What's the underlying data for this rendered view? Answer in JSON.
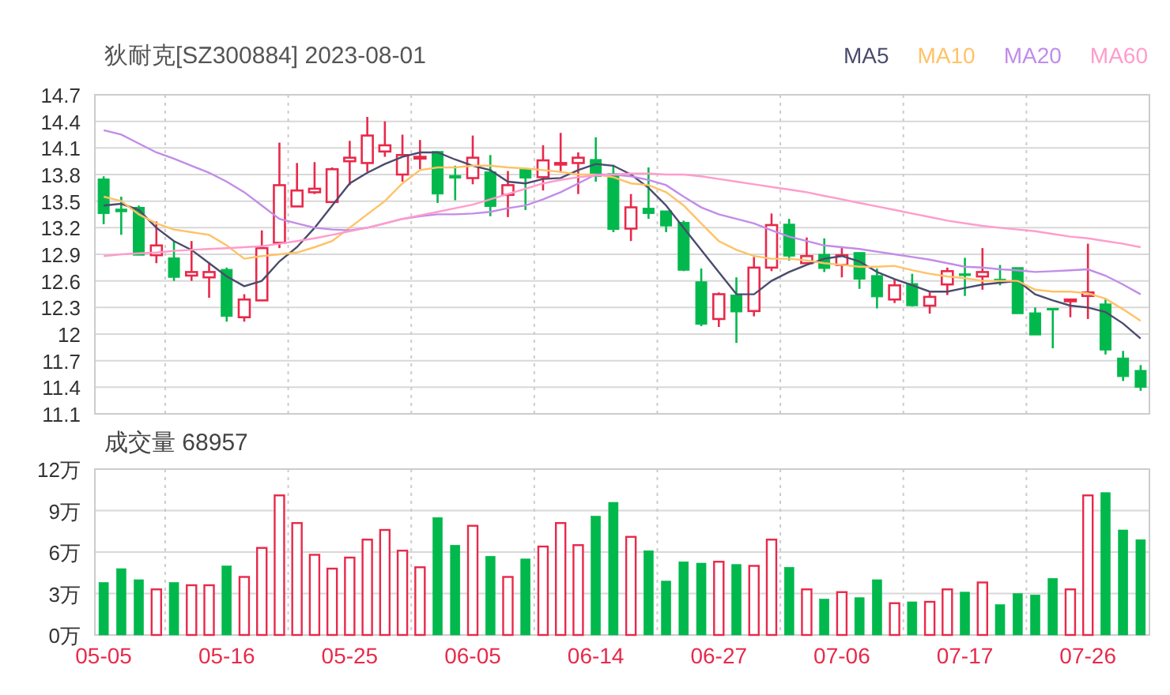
{
  "price_chart": {
    "chart_data": {
      "type": "line",
      "title": "狄耐克[SZ300884] 2023-08-01",
      "ylim": [
        11.1,
        14.7
      ],
      "categories": [
        null,
        null,
        null,
        null,
        null,
        null,
        null,
        null,
        null,
        null,
        null,
        null,
        null,
        null,
        null,
        null,
        null,
        null,
        null,
        null,
        null,
        null,
        null,
        null,
        null,
        null,
        null,
        null,
        null,
        null,
        null,
        null,
        null,
        null,
        null,
        null,
        null,
        null,
        null,
        null,
        null,
        null,
        null,
        null,
        null,
        null,
        null,
        null,
        null,
        null,
        null,
        null,
        null,
        null,
        null,
        null,
        null,
        null,
        null,
        null
      ],
      "series": [
        {
          "name": "MA5",
          "color": "#4b4b6e",
          "values": [
            13.45,
            13.47,
            13.4,
            13.2,
            13.05,
            12.95,
            12.8,
            12.65,
            12.54,
            12.6,
            12.82,
            12.98,
            13.2,
            13.45,
            13.7,
            13.82,
            13.92,
            14.0,
            14.05,
            14.05,
            13.97,
            13.9,
            13.85,
            13.72,
            13.7,
            13.75,
            13.76,
            13.85,
            13.92,
            13.9,
            13.8,
            13.65,
            13.45,
            13.2,
            12.95,
            12.7,
            12.45,
            12.45,
            12.6,
            12.7,
            12.78,
            12.85,
            12.88,
            12.82,
            12.7,
            12.62,
            12.55,
            12.48,
            12.48,
            12.52,
            12.56,
            12.58,
            12.6,
            12.45,
            12.38,
            12.32,
            12.3,
            12.25,
            12.12,
            11.95
          ]
        },
        {
          "name": "MA10",
          "color": "#ffc266",
          "values": [
            13.55,
            13.5,
            13.35,
            13.25,
            13.18,
            13.15,
            13.12,
            13.0,
            12.85,
            12.88,
            12.9,
            12.92,
            12.98,
            13.05,
            13.2,
            13.35,
            13.5,
            13.7,
            13.85,
            13.88,
            13.88,
            13.9,
            13.9,
            13.88,
            13.87,
            13.85,
            13.83,
            13.8,
            13.8,
            13.77,
            13.7,
            13.68,
            13.6,
            13.45,
            13.25,
            13.05,
            12.95,
            12.88,
            12.85,
            12.85,
            12.83,
            12.8,
            12.78,
            12.76,
            12.76,
            12.77,
            12.72,
            12.68,
            12.65,
            12.63,
            12.6,
            12.6,
            12.6,
            12.5,
            12.48,
            12.48,
            12.46,
            12.4,
            12.28,
            12.15
          ]
        },
        {
          "name": "MA20",
          "color": "#c28ce8",
          "values": [
            14.3,
            14.25,
            14.15,
            14.05,
            13.98,
            13.9,
            13.82,
            13.72,
            13.6,
            13.45,
            13.3,
            13.25,
            13.2,
            13.18,
            13.17,
            13.2,
            13.25,
            13.3,
            13.33,
            13.35,
            13.35,
            13.36,
            13.38,
            13.42,
            13.45,
            13.52,
            13.6,
            13.7,
            13.8,
            13.8,
            13.78,
            13.74,
            13.68,
            13.55,
            13.43,
            13.35,
            13.3,
            13.25,
            13.17,
            13.1,
            13.05,
            13.0,
            12.98,
            12.96,
            12.93,
            12.9,
            12.87,
            12.84,
            12.8,
            12.76,
            12.75,
            12.73,
            12.72,
            12.7,
            12.71,
            12.72,
            12.73,
            12.66,
            12.56,
            12.45
          ]
        },
        {
          "name": "MA60",
          "color": "#ff9ccc",
          "values": [
            12.88,
            12.9,
            12.91,
            12.92,
            12.94,
            12.95,
            12.96,
            12.97,
            12.98,
            12.99,
            13.02,
            13.05,
            13.08,
            13.12,
            13.16,
            13.2,
            13.25,
            13.3,
            13.34,
            13.38,
            13.42,
            13.46,
            13.52,
            13.58,
            13.64,
            13.7,
            13.74,
            13.77,
            13.79,
            13.8,
            13.81,
            13.81,
            13.8,
            13.8,
            13.78,
            13.75,
            13.72,
            13.69,
            13.66,
            13.63,
            13.6,
            13.56,
            13.52,
            13.48,
            13.44,
            13.4,
            13.36,
            13.32,
            13.28,
            13.25,
            13.22,
            13.2,
            13.18,
            13.16,
            13.13,
            13.1,
            13.08,
            13.05,
            13.02,
            12.98
          ]
        }
      ]
    }
  },
  "candles": {
    "chart_data": {
      "type": "candlestick",
      "ylim": [
        11.1,
        14.7
      ],
      "grid": true,
      "yticks": [
        {
          "value": 14.7,
          "label": "14.7"
        },
        {
          "value": 14.4,
          "label": "14.4"
        },
        {
          "value": 14.1,
          "label": "14.1"
        },
        {
          "value": 13.8,
          "label": "13.8"
        },
        {
          "value": 13.5,
          "label": "13.5"
        },
        {
          "value": 13.2,
          "label": "13.2"
        },
        {
          "value": 12.9,
          "label": "12.9"
        },
        {
          "value": 12.6,
          "label": "12.6"
        },
        {
          "value": 12.3,
          "label": "12.3"
        },
        {
          "value": 12,
          "label": "12"
        },
        {
          "value": 11.7,
          "label": "11.7"
        },
        {
          "value": 11.4,
          "label": "11.4"
        },
        {
          "value": 11.1,
          "label": "11.1"
        }
      ],
      "categories": [
        null,
        null,
        null,
        null,
        null,
        null,
        null,
        null,
        null,
        null,
        null,
        null,
        null,
        null,
        null,
        null,
        null,
        null,
        null,
        null,
        null,
        null,
        null,
        null,
        null,
        null,
        null,
        null,
        null,
        null,
        null,
        null,
        null,
        null,
        null,
        null,
        null,
        null,
        null,
        null,
        null,
        null,
        null,
        null,
        null,
        null,
        null,
        null,
        null,
        null,
        null,
        null,
        null,
        null,
        null,
        null,
        null,
        null,
        null,
        null
      ],
      "ohlc": [
        [
          13.75,
          13.78,
          13.24,
          13.36
        ],
        [
          13.41,
          13.55,
          13.12,
          13.38
        ],
        [
          13.43,
          13.45,
          12.89,
          12.89
        ],
        [
          12.89,
          13.27,
          12.8,
          13.0
        ],
        [
          12.86,
          13.05,
          12.6,
          12.64
        ],
        [
          12.66,
          13.05,
          12.6,
          12.7
        ],
        [
          12.64,
          12.81,
          12.41,
          12.7
        ],
        [
          12.73,
          12.75,
          12.14,
          12.2
        ],
        [
          12.19,
          12.45,
          12.14,
          12.39
        ],
        [
          12.38,
          13.17,
          12.38,
          12.97
        ],
        [
          13.03,
          14.16,
          12.97,
          13.68
        ],
        [
          13.44,
          13.93,
          13.44,
          13.62
        ],
        [
          13.6,
          13.94,
          13.58,
          13.64
        ],
        [
          13.49,
          13.88,
          13.49,
          13.86
        ],
        [
          13.95,
          14.18,
          13.68,
          13.99
        ],
        [
          13.93,
          14.45,
          13.83,
          14.24
        ],
        [
          14.06,
          14.4,
          14.0,
          14.13
        ],
        [
          13.8,
          14.25,
          13.72,
          14.02
        ],
        [
          13.98,
          14.19,
          13.86,
          14.0
        ],
        [
          14.06,
          14.06,
          13.48,
          13.58
        ],
        [
          13.79,
          13.9,
          13.51,
          13.76
        ],
        [
          13.76,
          14.24,
          13.69,
          13.99
        ],
        [
          13.83,
          14.02,
          13.33,
          13.44
        ],
        [
          13.57,
          13.84,
          13.32,
          13.68
        ],
        [
          13.86,
          13.88,
          13.4,
          13.76
        ],
        [
          13.77,
          14.13,
          13.62,
          13.96
        ],
        [
          13.92,
          14.27,
          13.82,
          13.93
        ],
        [
          13.93,
          14.05,
          13.58,
          13.99
        ],
        [
          13.97,
          14.22,
          13.72,
          13.78
        ],
        [
          13.81,
          13.91,
          13.15,
          13.18
        ],
        [
          13.19,
          13.58,
          13.05,
          13.43
        ],
        [
          13.42,
          13.88,
          13.3,
          13.36
        ],
        [
          13.39,
          13.39,
          13.15,
          13.22
        ],
        [
          13.26,
          13.28,
          12.71,
          12.72
        ],
        [
          12.59,
          12.74,
          12.09,
          12.11
        ],
        [
          12.17,
          12.47,
          12.08,
          12.45
        ],
        [
          12.44,
          12.64,
          11.9,
          12.25
        ],
        [
          12.26,
          12.87,
          12.2,
          12.75
        ],
        [
          12.75,
          13.36,
          12.71,
          13.23
        ],
        [
          13.24,
          13.3,
          12.83,
          12.88
        ],
        [
          12.8,
          13.09,
          12.8,
          12.88
        ],
        [
          12.9,
          13.08,
          12.7,
          12.74
        ],
        [
          12.78,
          12.99,
          12.64,
          12.89
        ],
        [
          12.92,
          12.92,
          12.51,
          12.62
        ],
        [
          12.66,
          12.74,
          12.29,
          12.42
        ],
        [
          12.39,
          12.62,
          12.35,
          12.55
        ],
        [
          12.57,
          12.68,
          12.31,
          12.32
        ],
        [
          12.32,
          12.47,
          12.23,
          12.42
        ],
        [
          12.56,
          12.75,
          12.44,
          12.71
        ],
        [
          12.68,
          12.86,
          12.43,
          12.66
        ],
        [
          12.65,
          12.97,
          12.5,
          12.7
        ],
        [
          12.62,
          12.78,
          12.55,
          12.6
        ],
        [
          12.75,
          12.75,
          12.23,
          12.23
        ],
        [
          12.24,
          12.3,
          11.99,
          11.99
        ],
        [
          12.29,
          12.29,
          11.84,
          12.28
        ],
        [
          12.37,
          12.4,
          12.19,
          12.39
        ],
        [
          12.43,
          13.02,
          12.17,
          12.47
        ],
        [
          12.34,
          12.39,
          11.77,
          11.82
        ],
        [
          11.73,
          11.81,
          11.47,
          11.52
        ],
        [
          11.59,
          11.65,
          11.36,
          11.4
        ]
      ]
    }
  },
  "volume_chart": {
    "chart_data": {
      "type": "bar",
      "title": "成交量 68957",
      "ylim": [
        0,
        12
      ],
      "grid": true,
      "yticks": [
        {
          "value": 12,
          "label": "12万"
        },
        {
          "value": 9,
          "label": "9万"
        },
        {
          "value": 6,
          "label": "6万"
        },
        {
          "value": 3,
          "label": "3万"
        },
        {
          "value": 0,
          "label": "0万"
        }
      ],
      "categories": [
        "05-05",
        null,
        null,
        null,
        null,
        null,
        null,
        "05-16",
        null,
        null,
        null,
        null,
        null,
        null,
        "05-25",
        null,
        null,
        null,
        null,
        null,
        null,
        "06-05",
        null,
        null,
        null,
        null,
        null,
        null,
        "06-14",
        null,
        null,
        null,
        null,
        null,
        null,
        "06-27",
        null,
        null,
        null,
        null,
        null,
        null,
        "07-06",
        null,
        null,
        null,
        null,
        null,
        null,
        "07-17",
        null,
        null,
        null,
        null,
        null,
        null,
        "07-26",
        null,
        null,
        null
      ],
      "values": [
        3.8,
        4.8,
        4.0,
        3.3,
        3.8,
        3.6,
        3.6,
        5.0,
        4.2,
        6.3,
        10.1,
        8.1,
        5.8,
        4.8,
        5.6,
        6.9,
        7.6,
        6.1,
        4.9,
        8.5,
        6.5,
        7.9,
        5.7,
        4.2,
        5.5,
        6.4,
        8.1,
        6.5,
        8.6,
        9.6,
        7.1,
        6.1,
        3.9,
        5.3,
        5.2,
        5.3,
        5.1,
        5.0,
        6.9,
        4.9,
        3.3,
        2.6,
        3.1,
        2.7,
        4.0,
        2.3,
        2.4,
        2.4,
        3.3,
        3.1,
        3.8,
        2.2,
        3.0,
        2.9,
        4.1,
        3.3,
        10.1,
        10.3,
        7.6,
        6.9
      ]
    }
  }
}
